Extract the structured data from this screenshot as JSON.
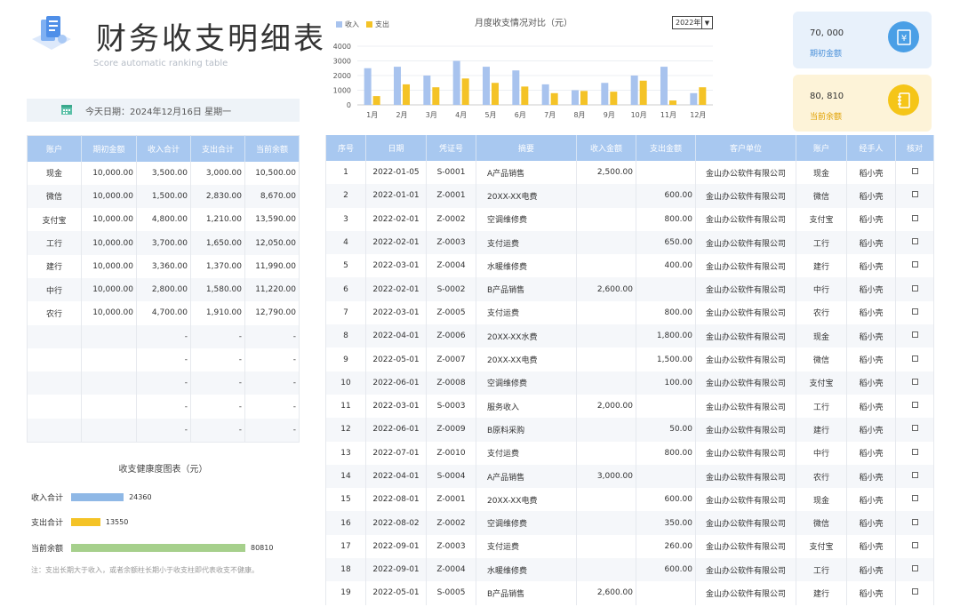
{
  "header": {
    "title": "财务收支明细表",
    "subtitle": "Score automatic ranking table",
    "today_label": "今天日期：",
    "today_value": "2024年12月16日 星期一"
  },
  "chart_data": {
    "type": "bar",
    "title": "月度收支情况对比（元）",
    "categories": [
      "1月",
      "2月",
      "3月",
      "4月",
      "5月",
      "6月",
      "7月",
      "8月",
      "9月",
      "10月",
      "11月",
      "12月"
    ],
    "series": [
      {
        "name": "收入",
        "color": "#a8c3ee",
        "values": [
          2500,
          2600,
          2000,
          3000,
          2600,
          2350,
          1400,
          1000,
          1500,
          2000,
          2600,
          800
        ]
      },
      {
        "name": "支出",
        "color": "#f4c327",
        "values": [
          600,
          1400,
          1200,
          1800,
          1500,
          1250,
          800,
          950,
          900,
          1650,
          300,
          1200
        ]
      }
    ],
    "yticks": [
      0,
      1000,
      2000,
      3000,
      4000
    ],
    "ylim": [
      0,
      4000
    ],
    "legend": "top-left",
    "grid": true
  },
  "year_select": {
    "value": "2022年",
    "arrow": "▼"
  },
  "cards": {
    "opening": {
      "amount": "70, 000",
      "label": "期初金额",
      "icon": "yuan-receipt-icon"
    },
    "current": {
      "amount": "80, 810",
      "label": "当前余额",
      "icon": "notebook-icon"
    }
  },
  "accounts": {
    "headers": [
      "账户",
      "期初金额",
      "收入合计",
      "支出合计",
      "当前余额"
    ],
    "rows": [
      [
        "现金",
        "10,000.00",
        "3,500.00",
        "3,000.00",
        "10,500.00"
      ],
      [
        "微信",
        "10,000.00",
        "1,500.00",
        "2,830.00",
        "8,670.00"
      ],
      [
        "支付宝",
        "10,000.00",
        "4,800.00",
        "1,210.00",
        "13,590.00"
      ],
      [
        "工行",
        "10,000.00",
        "3,700.00",
        "1,650.00",
        "12,050.00"
      ],
      [
        "建行",
        "10,000.00",
        "3,360.00",
        "1,370.00",
        "11,990.00"
      ],
      [
        "中行",
        "10,000.00",
        "2,800.00",
        "1,580.00",
        "11,220.00"
      ],
      [
        "农行",
        "10,000.00",
        "4,700.00",
        "1,910.00",
        "12,790.00"
      ],
      [
        "",
        "",
        "-",
        "-",
        "-"
      ],
      [
        "",
        "",
        "-",
        "-",
        "-"
      ],
      [
        "",
        "",
        "-",
        "-",
        "-"
      ],
      [
        "",
        "",
        "-",
        "-",
        "-"
      ],
      [
        "",
        "",
        "-",
        "-",
        "-"
      ]
    ]
  },
  "details": {
    "headers": [
      "序号",
      "日期",
      "凭证号",
      "摘要",
      "收入金额",
      "支出金额",
      "客户单位",
      "账户",
      "经手人",
      "核对"
    ],
    "rows": [
      [
        "1",
        "2022-01-05",
        "S-0001",
        "A产品销售",
        "2,500.00",
        "",
        "金山办公软件有限公司",
        "现金",
        "稻小壳"
      ],
      [
        "2",
        "2022-01-01",
        "Z-0001",
        "20XX-XX电费",
        "",
        "600.00",
        "金山办公软件有限公司",
        "微信",
        "稻小壳"
      ],
      [
        "3",
        "2022-02-01",
        "Z-0002",
        "空调维修费",
        "",
        "800.00",
        "金山办公软件有限公司",
        "支付宝",
        "稻小壳"
      ],
      [
        "4",
        "2022-02-01",
        "Z-0003",
        "支付运费",
        "",
        "650.00",
        "金山办公软件有限公司",
        "工行",
        "稻小壳"
      ],
      [
        "5",
        "2022-03-01",
        "Z-0004",
        "水暖维修费",
        "",
        "400.00",
        "金山办公软件有限公司",
        "建行",
        "稻小壳"
      ],
      [
        "6",
        "2022-02-01",
        "S-0002",
        "B产品销售",
        "2,600.00",
        "",
        "金山办公软件有限公司",
        "中行",
        "稻小壳"
      ],
      [
        "7",
        "2022-03-01",
        "Z-0005",
        "支付运费",
        "",
        "800.00",
        "金山办公软件有限公司",
        "农行",
        "稻小壳"
      ],
      [
        "8",
        "2022-04-01",
        "Z-0006",
        "20XX-XX水费",
        "",
        "1,800.00",
        "金山办公软件有限公司",
        "现金",
        "稻小壳"
      ],
      [
        "9",
        "2022-05-01",
        "Z-0007",
        "20XX-XX电费",
        "",
        "1,500.00",
        "金山办公软件有限公司",
        "微信",
        "稻小壳"
      ],
      [
        "10",
        "2022-06-01",
        "Z-0008",
        "空调维修费",
        "",
        "100.00",
        "金山办公软件有限公司",
        "支付宝",
        "稻小壳"
      ],
      [
        "11",
        "2022-03-01",
        "S-0003",
        "服务收入",
        "2,000.00",
        "",
        "金山办公软件有限公司",
        "工行",
        "稻小壳"
      ],
      [
        "12",
        "2022-06-01",
        "Z-0009",
        "B原料采购",
        "",
        "50.00",
        "金山办公软件有限公司",
        "建行",
        "稻小壳"
      ],
      [
        "13",
        "2022-07-01",
        "Z-0010",
        "支付运费",
        "",
        "800.00",
        "金山办公软件有限公司",
        "中行",
        "稻小壳"
      ],
      [
        "14",
        "2022-04-01",
        "S-0004",
        "A产品销售",
        "3,000.00",
        "",
        "金山办公软件有限公司",
        "农行",
        "稻小壳"
      ],
      [
        "15",
        "2022-08-01",
        "Z-0001",
        "20XX-XX电费",
        "",
        "600.00",
        "金山办公软件有限公司",
        "现金",
        "稻小壳"
      ],
      [
        "16",
        "2022-08-02",
        "Z-0002",
        "空调维修费",
        "",
        "350.00",
        "金山办公软件有限公司",
        "微信",
        "稻小壳"
      ],
      [
        "17",
        "2022-09-01",
        "Z-0003",
        "支付运费",
        "",
        "260.00",
        "金山办公软件有限公司",
        "支付宝",
        "稻小壳"
      ],
      [
        "18",
        "2022-09-01",
        "Z-0004",
        "水暖维修费",
        "",
        "600.00",
        "金山办公软件有限公司",
        "工行",
        "稻小壳"
      ],
      [
        "19",
        "2022-05-01",
        "S-0005",
        "B产品销售",
        "2,600.00",
        "",
        "金山办公软件有限公司",
        "建行",
        "稻小壳"
      ]
    ]
  },
  "health": {
    "title": "收支健康度图表（元）",
    "max": 80810,
    "items": [
      {
        "label": "收入合计",
        "value": 24360,
        "display": "24360",
        "color": "#8fb8e6"
      },
      {
        "label": "支出合计",
        "value": 13550,
        "display": "13550",
        "color": "#f4c327"
      },
      {
        "label": "当前余额",
        "value": 80810,
        "display": "80810",
        "color": "#a6d08c"
      }
    ],
    "note": "注：支出长期大于收入，或者余额柱长期小于收支柱即代表收支不健康。"
  }
}
